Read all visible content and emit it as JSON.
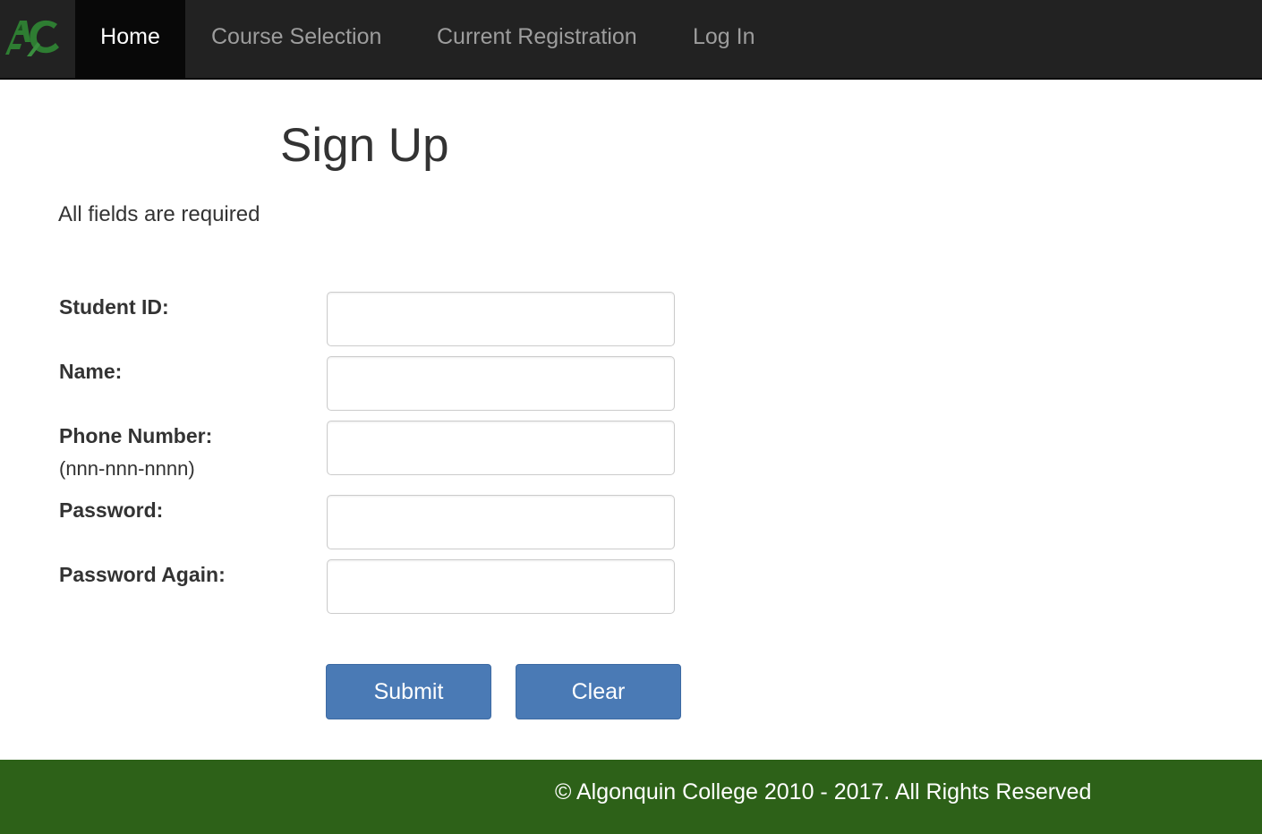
{
  "nav": {
    "logo": "AC",
    "items": [
      {
        "label": "Home",
        "active": true
      },
      {
        "label": "Course Selection",
        "active": false
      },
      {
        "label": "Current Registration",
        "active": false
      },
      {
        "label": "Log In",
        "active": false
      }
    ]
  },
  "page": {
    "title": "Sign Up",
    "note": "All fields are required"
  },
  "form": {
    "fields": [
      {
        "label": "Student ID:",
        "value": ""
      },
      {
        "label": "Name:",
        "value": ""
      },
      {
        "label": "Phone Number:",
        "hint": "(nnn-nnn-nnnn)",
        "value": ""
      },
      {
        "label": "Password:",
        "value": ""
      },
      {
        "label": "Password Again:",
        "value": ""
      }
    ],
    "submit_label": "Submit",
    "clear_label": "Clear"
  },
  "footer": {
    "text": "© Algonquin College 2010 - 2017. All Rights Reserved"
  },
  "colors": {
    "navbar": "#222222",
    "button": "#4a7ab5",
    "footer": "#2d6118",
    "logo": "#2e7d32"
  }
}
